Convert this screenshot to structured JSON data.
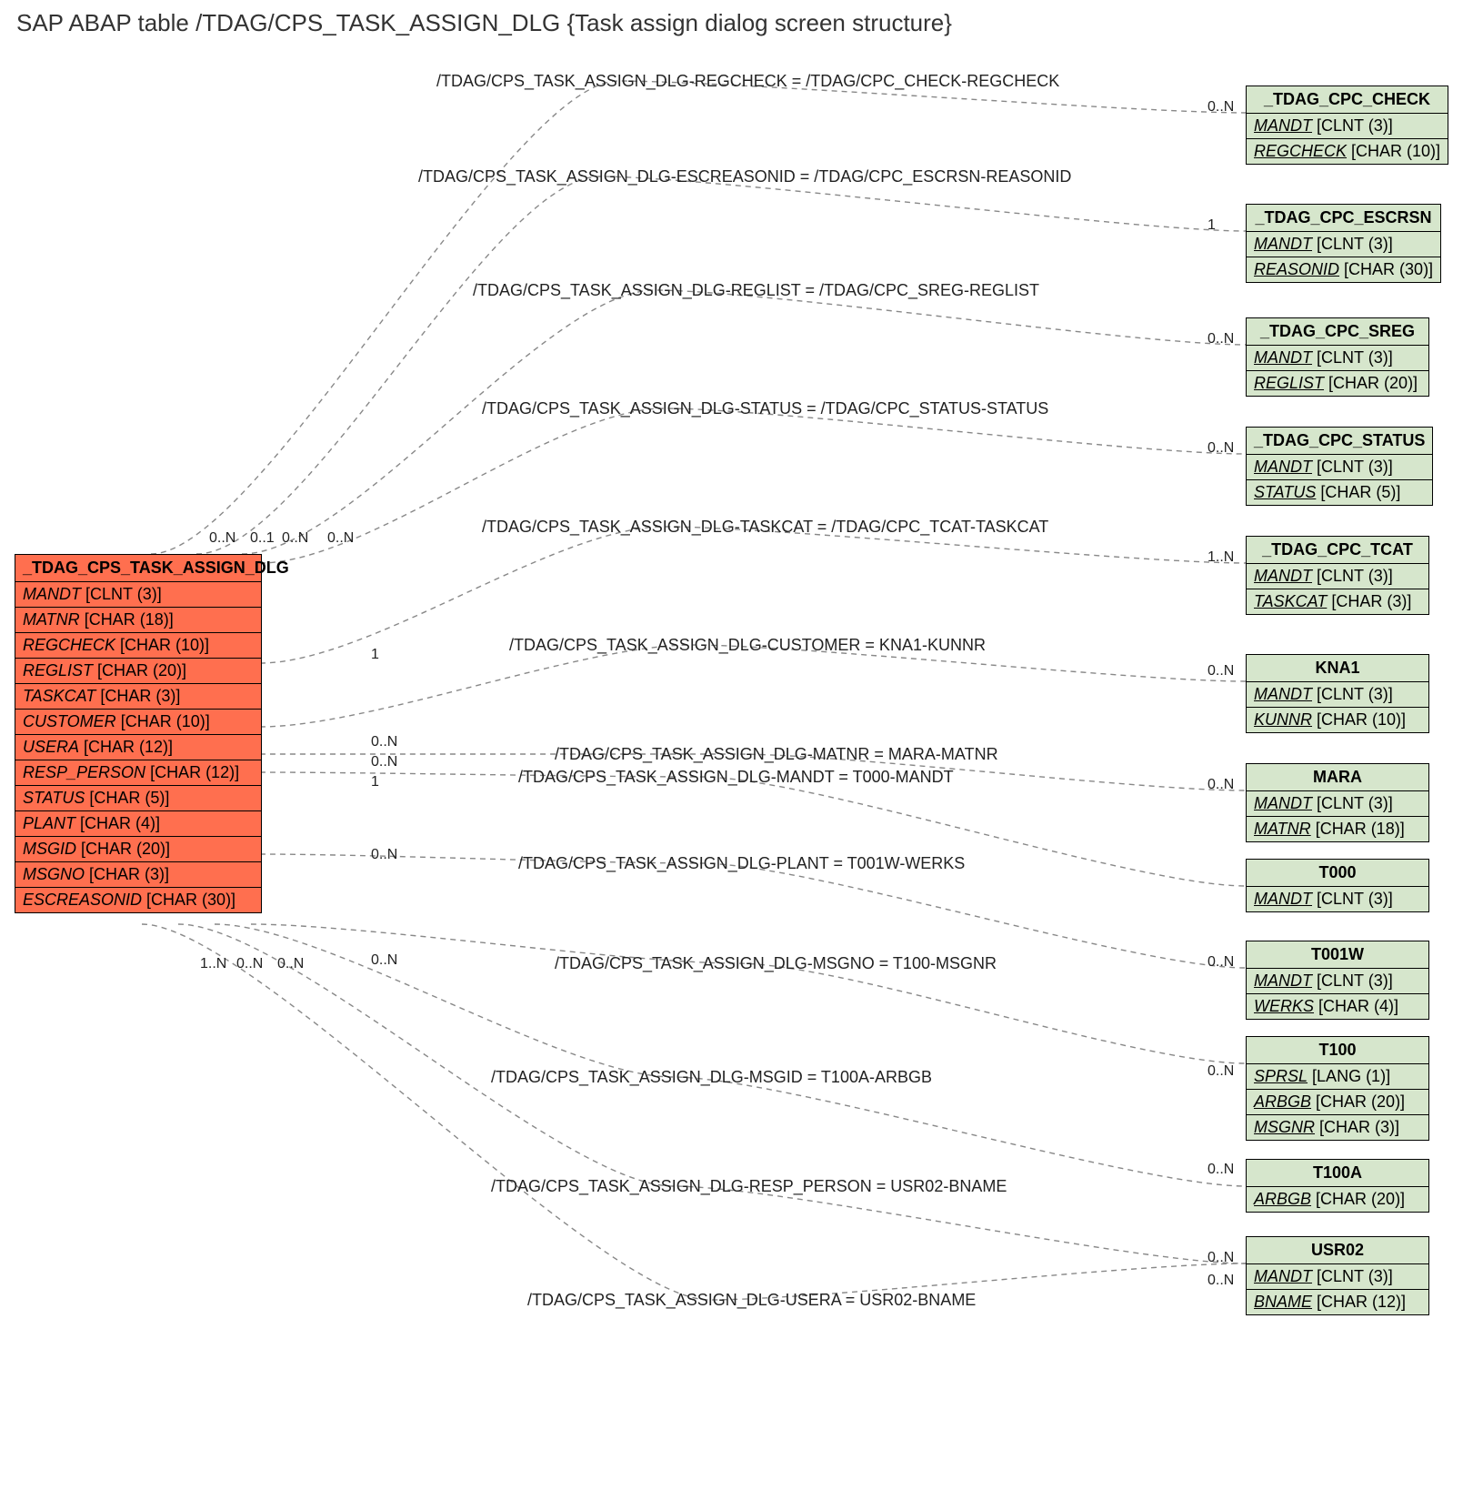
{
  "title": "SAP ABAP table /TDAG/CPS_TASK_ASSIGN_DLG {Task assign dialog screen structure}",
  "main": {
    "name": "_TDAG_CPS_TASK_ASSIGN_DLG",
    "rows": [
      {
        "f": "MANDT",
        "t": "[CLNT (3)]"
      },
      {
        "f": "MATNR",
        "t": "[CHAR (18)]"
      },
      {
        "f": "REGCHECK",
        "t": "[CHAR (10)]"
      },
      {
        "f": "REGLIST",
        "t": "[CHAR (20)]"
      },
      {
        "f": "TASKCAT",
        "t": "[CHAR (3)]"
      },
      {
        "f": "CUSTOMER",
        "t": "[CHAR (10)]"
      },
      {
        "f": "USERA",
        "t": "[CHAR (12)]"
      },
      {
        "f": "RESP_PERSON",
        "t": "[CHAR (12)]"
      },
      {
        "f": "STATUS",
        "t": "[CHAR (5)]"
      },
      {
        "f": "PLANT",
        "t": "[CHAR (4)]"
      },
      {
        "f": "MSGID",
        "t": "[CHAR (20)]"
      },
      {
        "f": "MSGNO",
        "t": "[CHAR (3)]"
      },
      {
        "f": "ESCREASONID",
        "t": "[CHAR (30)]"
      }
    ]
  },
  "relations": [
    {
      "label": "/TDAG/CPS_TASK_ASSIGN_DLG-REGCHECK = /TDAG/CPC_CHECK-REGCHECK",
      "rcard": "0..N"
    },
    {
      "label": "/TDAG/CPS_TASK_ASSIGN_DLG-ESCREASONID = /TDAG/CPC_ESCRSN-REASONID",
      "rcard": "1"
    },
    {
      "label": "/TDAG/CPS_TASK_ASSIGN_DLG-REGLIST = /TDAG/CPC_SREG-REGLIST",
      "rcard": "0..N"
    },
    {
      "label": "/TDAG/CPS_TASK_ASSIGN_DLG-STATUS = /TDAG/CPC_STATUS-STATUS",
      "rcard": "0..N"
    },
    {
      "label": "/TDAG/CPS_TASK_ASSIGN_DLG-TASKCAT = /TDAG/CPC_TCAT-TASKCAT",
      "rcard": "1..N"
    },
    {
      "label": "/TDAG/CPS_TASK_ASSIGN_DLG-CUSTOMER = KNA1-KUNNR",
      "rcard": "0..N"
    },
    {
      "label": "/TDAG/CPS_TASK_ASSIGN_DLG-MATNR = MARA-MATNR",
      "rcard": "0..N"
    },
    {
      "label": "/TDAG/CPS_TASK_ASSIGN_DLG-MANDT = T000-MANDT",
      "rcard": ""
    },
    {
      "label": "/TDAG/CPS_TASK_ASSIGN_DLG-PLANT = T001W-WERKS",
      "rcard": "0..N"
    },
    {
      "label": "/TDAG/CPS_TASK_ASSIGN_DLG-MSGNO = T100-MSGNR",
      "rcard": "0..N"
    },
    {
      "label": "/TDAG/CPS_TASK_ASSIGN_DLG-MSGID = T100A-ARBGB",
      "rcard": "0..N"
    },
    {
      "label": "/TDAG/CPS_TASK_ASSIGN_DLG-RESP_PERSON = USR02-BNAME",
      "rcard": "0..N"
    },
    {
      "label": "/TDAG/CPS_TASK_ASSIGN_DLG-USERA = USR02-BNAME",
      "rcard": "0..N"
    }
  ],
  "targets": [
    {
      "name": "_TDAG_CPC_CHECK",
      "rows": [
        {
          "f": "MANDT",
          "t": "[CLNT (3)]",
          "k": 1
        },
        {
          "f": "REGCHECK",
          "t": "[CHAR (10)]",
          "k": 1
        }
      ]
    },
    {
      "name": "_TDAG_CPC_ESCRSN",
      "rows": [
        {
          "f": "MANDT",
          "t": "[CLNT (3)]",
          "k": 1
        },
        {
          "f": "REASONID",
          "t": "[CHAR (30)]",
          "k": 1
        }
      ]
    },
    {
      "name": "_TDAG_CPC_SREG",
      "rows": [
        {
          "f": "MANDT",
          "t": "[CLNT (3)]",
          "k": 1
        },
        {
          "f": "REGLIST",
          "t": "[CHAR (20)]",
          "k": 1
        }
      ]
    },
    {
      "name": "_TDAG_CPC_STATUS",
      "rows": [
        {
          "f": "MANDT",
          "t": "[CLNT (3)]",
          "k": 1
        },
        {
          "f": "STATUS",
          "t": "[CHAR (5)]",
          "k": 1
        }
      ]
    },
    {
      "name": "_TDAG_CPC_TCAT",
      "rows": [
        {
          "f": "MANDT",
          "t": "[CLNT (3)]",
          "k": 1
        },
        {
          "f": "TASKCAT",
          "t": "[CHAR (3)]",
          "k": 1
        }
      ]
    },
    {
      "name": "KNA1",
      "rows": [
        {
          "f": "MANDT",
          "t": "[CLNT (3)]",
          "k": 1
        },
        {
          "f": "KUNNR",
          "t": "[CHAR (10)]",
          "k": 1
        }
      ]
    },
    {
      "name": "MARA",
      "rows": [
        {
          "f": "MANDT",
          "t": "[CLNT (3)]",
          "k": 1
        },
        {
          "f": "MATNR",
          "t": "[CHAR (18)]",
          "k": 1
        }
      ]
    },
    {
      "name": "T000",
      "rows": [
        {
          "f": "MANDT",
          "t": "[CLNT (3)]",
          "k": 1
        }
      ]
    },
    {
      "name": "T001W",
      "rows": [
        {
          "f": "MANDT",
          "t": "[CLNT (3)]",
          "k": 1
        },
        {
          "f": "WERKS",
          "t": "[CHAR (4)]",
          "k": 1
        }
      ]
    },
    {
      "name": "T100",
      "rows": [
        {
          "f": "SPRSL",
          "t": "[LANG (1)]",
          "k": 1
        },
        {
          "f": "ARBGB",
          "t": "[CHAR (20)]",
          "k": 1
        },
        {
          "f": "MSGNR",
          "t": "[CHAR (3)]",
          "k": 1
        }
      ]
    },
    {
      "name": "T100A",
      "rows": [
        {
          "f": "ARBGB",
          "t": "[CHAR (20)]",
          "k": 1
        }
      ]
    },
    {
      "name": "USR02",
      "rows": [
        {
          "f": "MANDT",
          "t": "[CLNT (3)]",
          "k": 1
        },
        {
          "f": "BNAME",
          "t": "[CHAR (12)]",
          "k": 1
        }
      ]
    }
  ],
  "leftCards": {
    "topCluster": [
      "0..N",
      "0..1",
      "0..N",
      "0..N"
    ],
    "midTriple": [
      "1",
      "0..N",
      "0..N",
      "1"
    ],
    "midSingle": "0..N",
    "bottom": [
      "0..N",
      "1..N",
      "0..N",
      "0..N"
    ]
  }
}
